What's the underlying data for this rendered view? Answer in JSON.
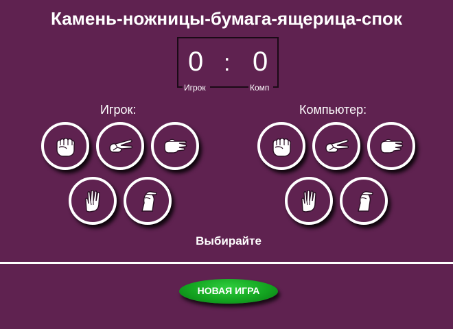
{
  "title": "Камень-ножницы-бумага-ящерица-спок",
  "score": {
    "player": "0",
    "separator": ":",
    "computer": "0",
    "player_label": "Игрок",
    "computer_label": "Комп"
  },
  "player_side": {
    "label": "Игрок:",
    "gestures": [
      "rock-icon",
      "scissors-icon",
      "paper-icon",
      "spock-icon",
      "lizard-icon"
    ]
  },
  "computer_side": {
    "label": "Компьютер:",
    "gestures": [
      "rock-icon",
      "scissors-icon",
      "paper-icon",
      "spock-icon",
      "lizard-icon"
    ]
  },
  "status": "Выбирайте",
  "new_game_label": "НОВАЯ ИГРА",
  "colors": {
    "background": "#5f2250",
    "button_green": "#14a521",
    "border_white": "#ffffff"
  }
}
